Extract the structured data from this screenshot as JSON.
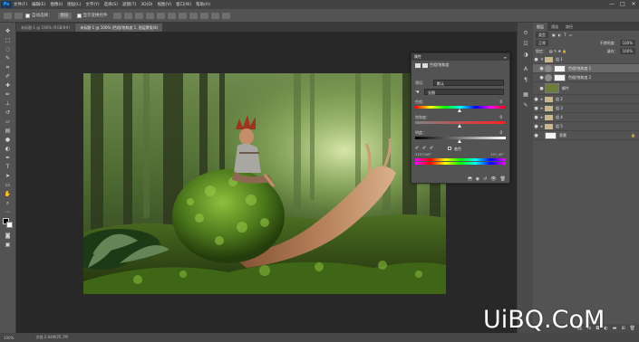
{
  "menubar": {
    "logo": "Ps",
    "items": [
      "文件(F)",
      "编辑(E)",
      "图像(I)",
      "图层(L)",
      "文字(Y)",
      "选择(S)",
      "滤镜(T)",
      "3D(D)",
      "视图(V)",
      "窗口(W)",
      "帮助(H)"
    ],
    "window_controls": [
      "—",
      "□",
      "✕"
    ]
  },
  "options_bar": {
    "auto_select_label": "自动选择：",
    "auto_select_target": "图层",
    "show_transform_label": "显示变换控件"
  },
  "tabs": [
    {
      "label": "未标题-1 @ 100% (RGB/8#)",
      "active": false
    },
    {
      "label": "未标题-1 @ 100% (色相/饱和度 1, 图层蒙版/8)",
      "active": true
    }
  ],
  "properties_panel": {
    "title": "属性",
    "subtitle": "色相/饱和度",
    "preset_label": "预设：",
    "preset_value": "默认",
    "channel_value": "全图",
    "hue_label": "色相：",
    "hue_value": "0",
    "saturation_label": "饱和度：",
    "saturation_value": "0",
    "lightness_label": "明度：",
    "lightness_value": "0",
    "colorize_label": "着色",
    "range_left": "315°/345°",
    "range_right": "15°\\ 45°"
  },
  "layers_panel": {
    "tabs": [
      "图层",
      "通道",
      "路径"
    ],
    "kind_label": "类型",
    "blend_mode": "正常",
    "opacity_label": "不透明度：",
    "opacity_value": "100%",
    "lock_label": "锁定：",
    "fill_label": "填充：",
    "fill_value": "100%",
    "layers": [
      {
        "name": "组 1",
        "type": "folder",
        "selected": false
      },
      {
        "name": "色相/饱和度 1",
        "type": "adjustment",
        "selected": true
      },
      {
        "name": "色相/饱和度 2",
        "type": "adjustment",
        "selected": false
      },
      {
        "name": "蜗牛",
        "type": "pixel",
        "selected": false
      },
      {
        "name": "组 2",
        "type": "folder",
        "selected": false
      },
      {
        "name": "组 3",
        "type": "folder",
        "selected": false
      },
      {
        "name": "组 4",
        "type": "folder",
        "selected": false
      },
      {
        "name": "组 5",
        "type": "folder",
        "selected": false
      },
      {
        "name": "背景",
        "type": "pixel",
        "selected": false
      }
    ]
  },
  "status_bar": {
    "zoom": "100%",
    "doc_info": "文档:2.64M/25.7M"
  },
  "watermark": "UiBQ.CoM",
  "colors": {
    "ui_dark": "#282828",
    "ui_panel": "#535353",
    "hue_bar_start": "#ff0000"
  }
}
